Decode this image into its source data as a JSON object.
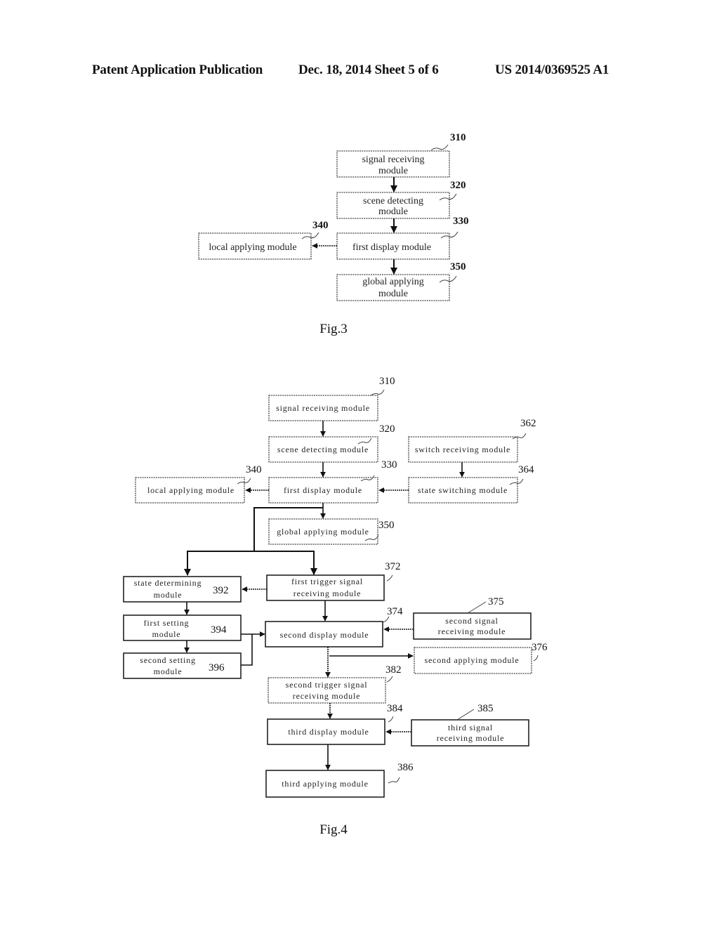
{
  "header": {
    "left": "Patent Application Publication",
    "middle": "Dec. 18, 2014   Sheet 5 of 6",
    "right": "US 2014/0369525 A1"
  },
  "fig3": {
    "caption": "Fig.3",
    "modules": [
      {
        "id": "310",
        "lines": [
          "signal receiving",
          "module"
        ]
      },
      {
        "id": "320",
        "lines": [
          "scene detecting",
          "module"
        ]
      },
      {
        "id": "330",
        "lines": [
          "first display module"
        ]
      },
      {
        "id": "340",
        "lines": [
          "local applying module"
        ]
      },
      {
        "id": "350",
        "lines": [
          "global applying",
          "module"
        ]
      }
    ]
  },
  "fig4": {
    "caption": "Fig.4",
    "modules": [
      {
        "id": "310",
        "lines": [
          "signal receiving module"
        ]
      },
      {
        "id": "320",
        "lines": [
          "scene detecting module"
        ]
      },
      {
        "id": "330",
        "lines": [
          "first display module"
        ]
      },
      {
        "id": "340",
        "lines": [
          "local applying module"
        ]
      },
      {
        "id": "350",
        "lines": [
          "global applying module"
        ]
      },
      {
        "id": "362",
        "lines": [
          "switch receiving module"
        ]
      },
      {
        "id": "364",
        "lines": [
          "state switching module"
        ]
      },
      {
        "id": "372",
        "lines": [
          "first trigger signal",
          "receiving module"
        ]
      },
      {
        "id": "374",
        "lines": [
          "second display module"
        ]
      },
      {
        "id": "375",
        "lines": [
          "second signal",
          "receiving module"
        ]
      },
      {
        "id": "376",
        "lines": [
          "second applying module"
        ]
      },
      {
        "id": "382",
        "lines": [
          "second trigger signal",
          "receiving module"
        ]
      },
      {
        "id": "384",
        "lines": [
          "third display module"
        ]
      },
      {
        "id": "385",
        "lines": [
          "third signal",
          "receiving module"
        ]
      },
      {
        "id": "386",
        "lines": [
          "third applying module"
        ]
      },
      {
        "id": "392",
        "lines": [
          "state determining",
          "module"
        ]
      },
      {
        "id": "394",
        "lines": [
          "first setting",
          "module"
        ]
      },
      {
        "id": "396",
        "lines": [
          "second setting",
          "module"
        ]
      }
    ]
  }
}
